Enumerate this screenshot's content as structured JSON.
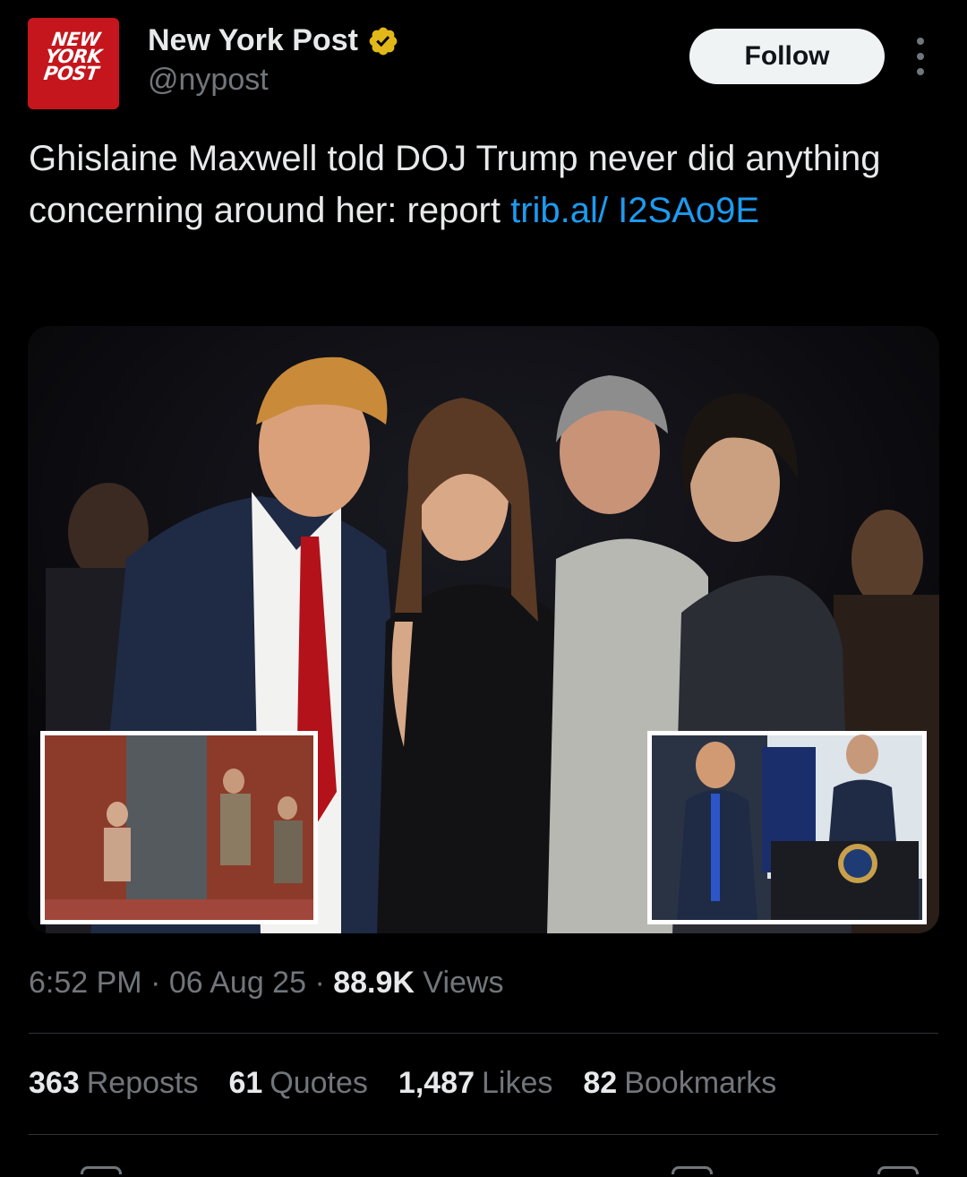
{
  "account": {
    "logo_text": "NEW YORK POST",
    "display_name": "New York Post",
    "handle": "@nypost",
    "verified_badge_color": "#e2b719"
  },
  "actions": {
    "follow_label": "Follow",
    "more_icon": "more-options-icon"
  },
  "tweet": {
    "text": "Ghislaine Maxwell told DOJ Trump never did anything concerning around her: report ",
    "link_text": "trib.al/ I2SAo9E"
  },
  "meta": {
    "time": "6:52 PM",
    "sep1": " · ",
    "date": "06 Aug 25",
    "sep2": " · ",
    "views_count": "88.9K",
    "views_label": " Views"
  },
  "stats": [
    {
      "count": "363",
      "label": "Reposts"
    },
    {
      "count": "61",
      "label": "Quotes"
    },
    {
      "count": "1,487",
      "label": "Likes"
    },
    {
      "count": "82",
      "label": "Bookmarks"
    }
  ],
  "colors": {
    "background": "#000000",
    "link": "#1d9bf0",
    "muted": "#71767b",
    "text": "#e7e9ea",
    "brand_red": "#c4161c"
  }
}
